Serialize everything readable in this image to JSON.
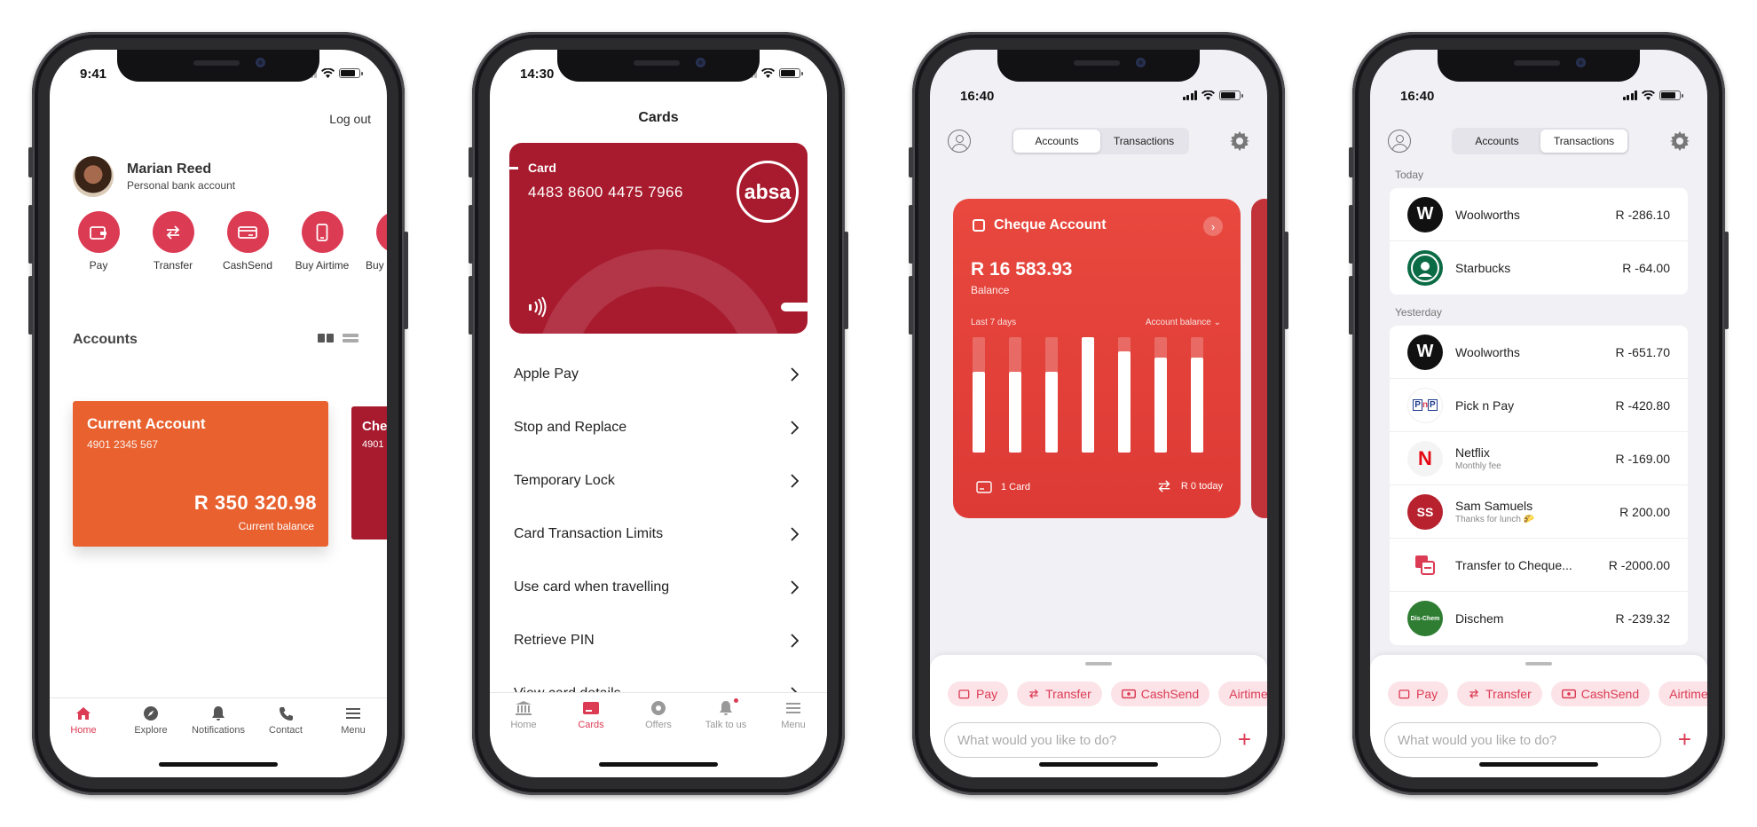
{
  "phone1": {
    "time": "9:41",
    "logout": "Log out",
    "user": {
      "name": "Marian Reed",
      "account_type": "Personal bank account"
    },
    "quick_actions": [
      {
        "label": "Pay",
        "icon": "wallet-icon"
      },
      {
        "label": "Transfer",
        "icon": "transfer-icon"
      },
      {
        "label": "CashSend",
        "icon": "cashsend-icon"
      },
      {
        "label": "Buy Airtime",
        "icon": "phone-icon"
      },
      {
        "label": "Buy Electricity",
        "icon": "bulb-icon"
      }
    ],
    "accounts_title": "Accounts",
    "account_card": {
      "title": "Current Account",
      "number": "4901 2345 567",
      "amount": "R 350 320.98",
      "balance_label": "Current balance"
    },
    "account_card_2": {
      "title": "Cheque",
      "number": "4901"
    },
    "tabs": [
      "Home",
      "Explore",
      "Notifications",
      "Contact",
      "Menu"
    ]
  },
  "phone2": {
    "time": "14:30",
    "title": "Cards",
    "card": {
      "label": "Card",
      "number": "4483 8600 4475 7966",
      "brand": "absa"
    },
    "menu": [
      "Apple Pay",
      "Stop and Replace",
      "Temporary Lock",
      "Card Transaction Limits",
      "Use card when travelling",
      "Retrieve PIN",
      "View card details"
    ],
    "tabs": [
      "Home",
      "Cards",
      "Offers",
      "Talk to us",
      "Menu"
    ]
  },
  "phone3": {
    "time": "16:40",
    "segments": [
      "Accounts",
      "Transactions"
    ],
    "card": {
      "title": "Cheque Account",
      "balance": "R 16 583.93",
      "balance_label": "Balance",
      "period": "Last 7 days",
      "metric": "Account balance",
      "bars": [
        0.7,
        0.7,
        0.7,
        1.0,
        0.88,
        0.82,
        0.82
      ],
      "cards_count": "1 Card",
      "today": "R 0 today"
    }
  },
  "phone4": {
    "time": "16:40",
    "segments": [
      "Accounts",
      "Transactions"
    ],
    "today_label": "Today",
    "yesterday_label": "Yesterday",
    "today": [
      {
        "name": "Woolworths",
        "amount": "R -286.10"
      },
      {
        "name": "Starbucks",
        "amount": "R -64.00"
      }
    ],
    "yesterday": [
      {
        "name": "Woolworths",
        "sub": "",
        "amount": "R -651.70"
      },
      {
        "name": "Pick n Pay",
        "sub": "",
        "amount": "R -420.80"
      },
      {
        "name": "Netflix",
        "sub": "Monthly fee",
        "amount": "R -169.00"
      },
      {
        "name": "Sam Samuels",
        "sub": "Thanks for lunch 🌮",
        "amount": "R 200.00",
        "initials": "SS"
      },
      {
        "name": "Transfer to Cheque...",
        "sub": "",
        "amount": "R -2000.00"
      },
      {
        "name": "Dischem",
        "sub": "",
        "amount": "R -239.32"
      }
    ]
  },
  "sheet": {
    "chips": [
      "Pay",
      "Transfer",
      "CashSend",
      "Airtime"
    ],
    "ask_placeholder": "What would you like to do?"
  },
  "colors": {
    "accent": "#dc3b54",
    "current_account": "#e8612f",
    "card_red": "#a81b2e",
    "cheque_card": "#e8483e"
  }
}
